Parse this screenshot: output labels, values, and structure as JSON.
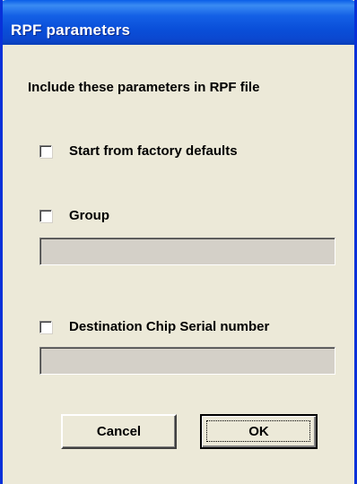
{
  "window": {
    "title": "RPF parameters"
  },
  "dialog": {
    "heading": "Include these parameters in RPF file",
    "options": {
      "factory_defaults": {
        "label": "Start from factory defaults",
        "checked": false
      },
      "group": {
        "label": "Group",
        "checked": false,
        "field_value": ""
      },
      "destination_serial": {
        "label": "Destination Chip Serial number",
        "checked": false,
        "field_value": ""
      }
    },
    "buttons": {
      "cancel_label": "Cancel",
      "ok_label": "OK"
    }
  },
  "colors": {
    "dialog_bg": "#ECE9D8",
    "titlebar_blue": "#0A4FD9",
    "disabled_field": "#D4D0C8"
  }
}
